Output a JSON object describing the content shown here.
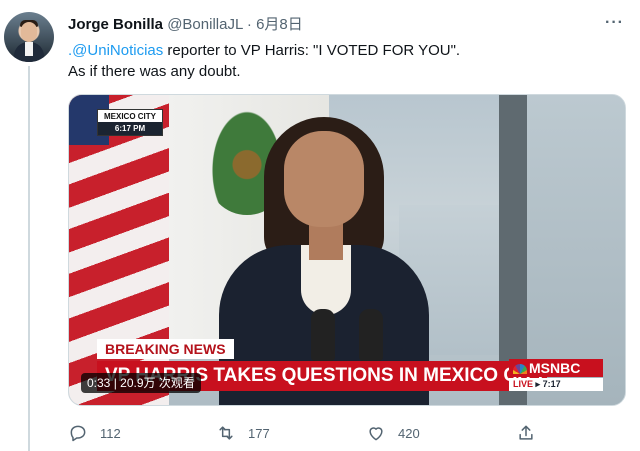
{
  "tweet": {
    "author_name": "Jorge Bonilla",
    "author_handle": "@BonillaJL",
    "separator": "·",
    "date": "6月8日",
    "more_label": "···",
    "text_mention": ".@UniNoticias",
    "text_line1_rest": " reporter to VP Harris: \"I VOTED FOR YOU\".",
    "text_line2": "As if there was any doubt."
  },
  "video": {
    "location": "MEXICO CITY",
    "location_time": "6:17 PM",
    "breaking_label": "BREAKING NEWS",
    "headline": "VP HARRIS TAKES QUESTIONS IN MEXICO CITY",
    "network": "MSNBC",
    "live_label": "LIVE",
    "live_time": "7:17",
    "duration": "0:33",
    "views": "20.9万 次观看"
  },
  "actions": {
    "replies": "112",
    "retweets": "177",
    "likes": "420"
  },
  "icons": [
    "reply-icon",
    "retweet-icon",
    "like-icon",
    "share-icon",
    "more-icon",
    "peacock-logo"
  ],
  "colors": {
    "accent": "#1d9bf0",
    "muted": "#536471",
    "breaking_red": "#c8101e"
  }
}
